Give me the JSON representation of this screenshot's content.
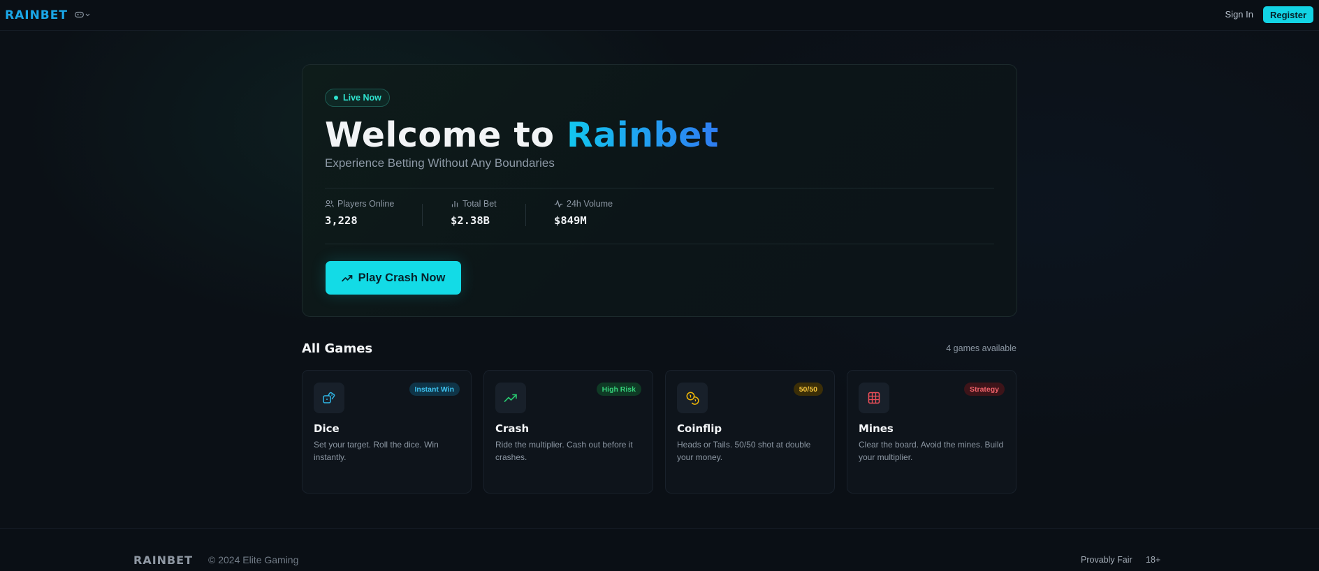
{
  "nav": {
    "logo": "RAINBET",
    "game_selector_icon": "gamepad-icon",
    "signin_label": "Sign In",
    "register_label": "Register"
  },
  "hero": {
    "badge": "Live Now",
    "title_prefix": "Welcome to ",
    "title_brand": "Rainbet",
    "subtitle": "Experience Betting Without Any Boundaries",
    "stats": [
      {
        "label": "Players Online",
        "value": "3,228",
        "icon": "users-icon"
      },
      {
        "label": "Total Bet",
        "value": "$2.38B",
        "icon": "bar-chart-icon"
      },
      {
        "label": "24h Volume",
        "value": "$849M",
        "icon": "activity-icon"
      }
    ],
    "cta_label": "Play Crash Now",
    "cta_icon": "trending-up-icon"
  },
  "games": {
    "title": "All Games",
    "count_label": "4 games available",
    "items": [
      {
        "name": "Dice",
        "badge": "Instant Win",
        "desc": "Set your target. Roll the dice. Win instantly.",
        "icon": "dice-icon",
        "accent": "#2fb7e8"
      },
      {
        "name": "Crash",
        "badge": "High Risk",
        "desc": "Ride the multiplier. Cash out before it crashes.",
        "icon": "trending-up-icon",
        "accent": "#28c76f"
      },
      {
        "name": "Coinflip",
        "badge": "50/50",
        "desc": "Heads or Tails. 50/50 shot at double your money.",
        "icon": "coins-icon",
        "accent": "#f2b807"
      },
      {
        "name": "Mines",
        "badge": "Strategy",
        "desc": "Clear the board. Avoid the mines. Build your multiplier.",
        "icon": "grid-icon",
        "accent": "#f0505a"
      }
    ]
  },
  "footer": {
    "logo": "RAINBET",
    "copyright": "© 2024 Elite Gaming",
    "provably_fair": "Provably Fair",
    "age": "18+"
  },
  "colors": {
    "accent_cyan": "#13dbe6",
    "brand_blue": "#1aa7e8",
    "background": "#0b1016"
  }
}
